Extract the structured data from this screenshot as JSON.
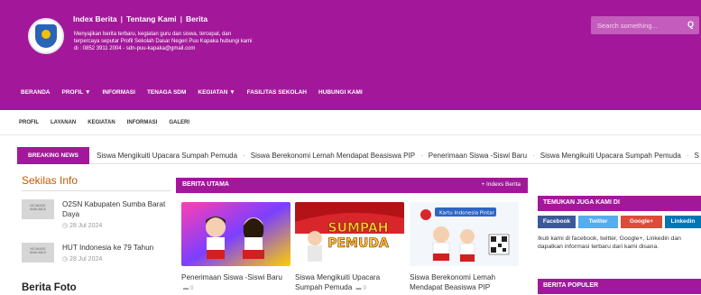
{
  "header": {
    "links": [
      "Index Berita",
      "Tentang Kami",
      "Berita"
    ],
    "separator": "|",
    "tagline": [
      "Menyajikan berita terbaru, kegiatan guru dan siswa, tercepat, dan",
      "terpercaya seputar Profil Sekolah Dasar Negeri Puu Kapaka hubungi kami",
      "di : 0852 3911 2004 - sdn-puu-kapaka@gmail.com"
    ],
    "search_placeholder": "Search something...",
    "search_icon": "Q"
  },
  "mainnav": [
    "BERANDA",
    "PROFIL ▼",
    "INFORMASI",
    "TENAGA SDM",
    "KEGIATAN ▼",
    "FASILITAS SEKOLAH",
    "HUBUNGI KAMI"
  ],
  "subnav": [
    "PROFIL",
    "LAYANAN",
    "KEGIATAN",
    "INFORMASI",
    "GALERI"
  ],
  "breaking": {
    "label": "BREAKING NEWS",
    "items": [
      "Siswa Mengikuiti Upacara Sumpah Pemuda",
      "Siswa Berekonomi Lemah Mendapat Beasiswa PIP",
      "Penerimaan Siswa -Siswi Baru",
      "Siswa Mengikuiti Upacara Sumpah Pemuda",
      "S"
    ],
    "dot": "·"
  },
  "sekilas": {
    "title": "Sekilas Info",
    "items": [
      {
        "title": "O2SN Kabupaten Sumba Barat Daya",
        "date": "◷ 28 Jul 2024"
      },
      {
        "title": "HUT Indonesia ke 79 Tahun",
        "date": "◷ 28 Jul 2024"
      }
    ],
    "thumb_text": "NO IMAGE AVAILABLE"
  },
  "berita_foto": "Berita Foto",
  "utama": {
    "title": "BERITA UTAMA",
    "index_link": "+ Indexs Berita",
    "cards": [
      {
        "caption": "Penerimaan Siswa -Siswi Baru",
        "comments": "0"
      },
      {
        "caption": "Siswa Mengikuiti Upacara Sumpah Pemuda",
        "comments": "0",
        "img_text": [
          "SUMPAH",
          "PEMUDA"
        ]
      },
      {
        "caption": "Siswa Berekonomi Lemah Mendapat Beasiswa PIP",
        "comments": "",
        "img_text": [
          "Kartu Indonesia Pintar"
        ]
      }
    ],
    "comment_icon": "▬"
  },
  "sidebar": {
    "temukan": "TEMUKAN JUGA KAMI DI",
    "social": [
      "Facebook",
      "Twitter",
      "Google+",
      "Linkedin"
    ],
    "social_colors": [
      "#3b5998",
      "#55acee",
      "#dd4b39",
      "#0077b5"
    ],
    "follow_text": "Ikuti kami di facebook, twitter, Google+, Linkedin dan dapatkan informasi terbaru dari kami disana.",
    "populer": "BERITA POPULER"
  },
  "colors": {
    "brand": "#a3189a",
    "accent": "#c15a00"
  }
}
